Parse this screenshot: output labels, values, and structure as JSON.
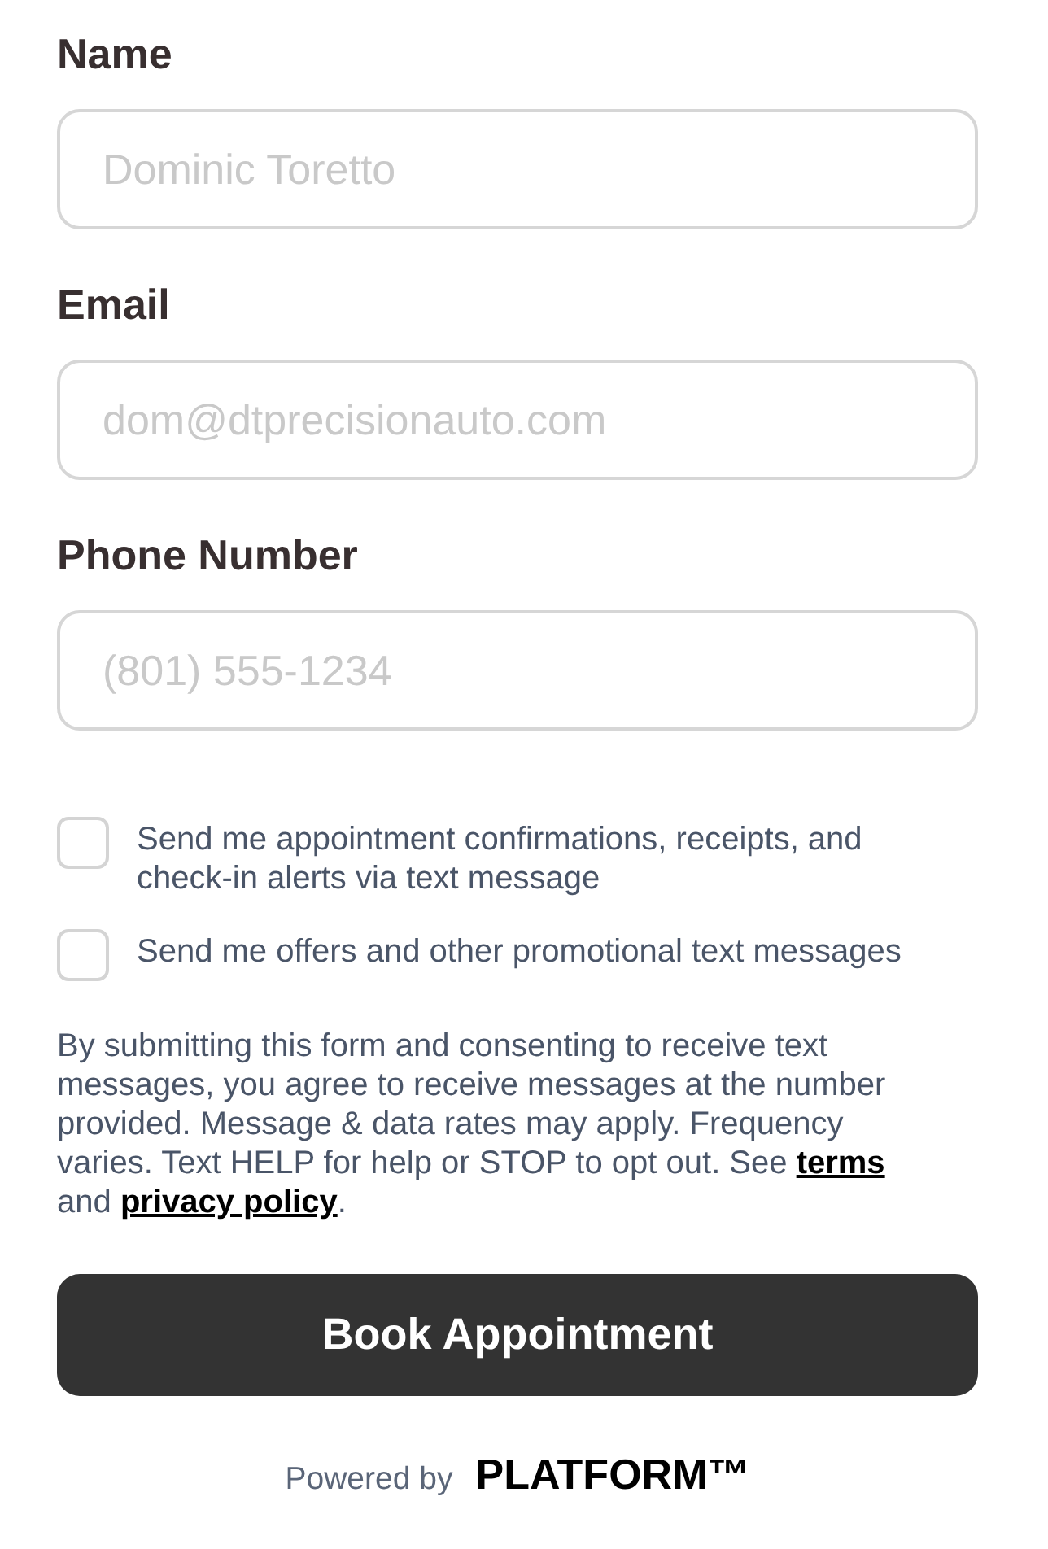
{
  "fields": [
    {
      "label": "Name",
      "placeholder": "Dominic Toretto"
    },
    {
      "label": "Email",
      "placeholder": "dom@dtprecisionauto.com"
    },
    {
      "label": "Phone Number",
      "placeholder": "(801) 555-1234"
    }
  ],
  "checkboxes": [
    {
      "label": "Send me appointment confirmations, receipts, and check-in alerts via text message",
      "checked": false
    },
    {
      "label": "Send me offers and other promotional text messages",
      "checked": false
    }
  ],
  "consent": [
    {
      "kind": "text",
      "text": "By submitting this form and consenting to receive text messages, you agree to receive messages at the number provided. Message & data rates may apply. Frequency varies. Text HELP for help or STOP to opt out. See "
    },
    {
      "kind": "link",
      "text": "terms"
    },
    {
      "kind": "text",
      "text": " and "
    },
    {
      "kind": "link",
      "text": "privacy policy"
    },
    {
      "kind": "text",
      "text": "."
    }
  ],
  "submit_button": "Book Appointment",
  "footer": {
    "text": "Powered by",
    "logo": "PLATFORM™"
  }
}
